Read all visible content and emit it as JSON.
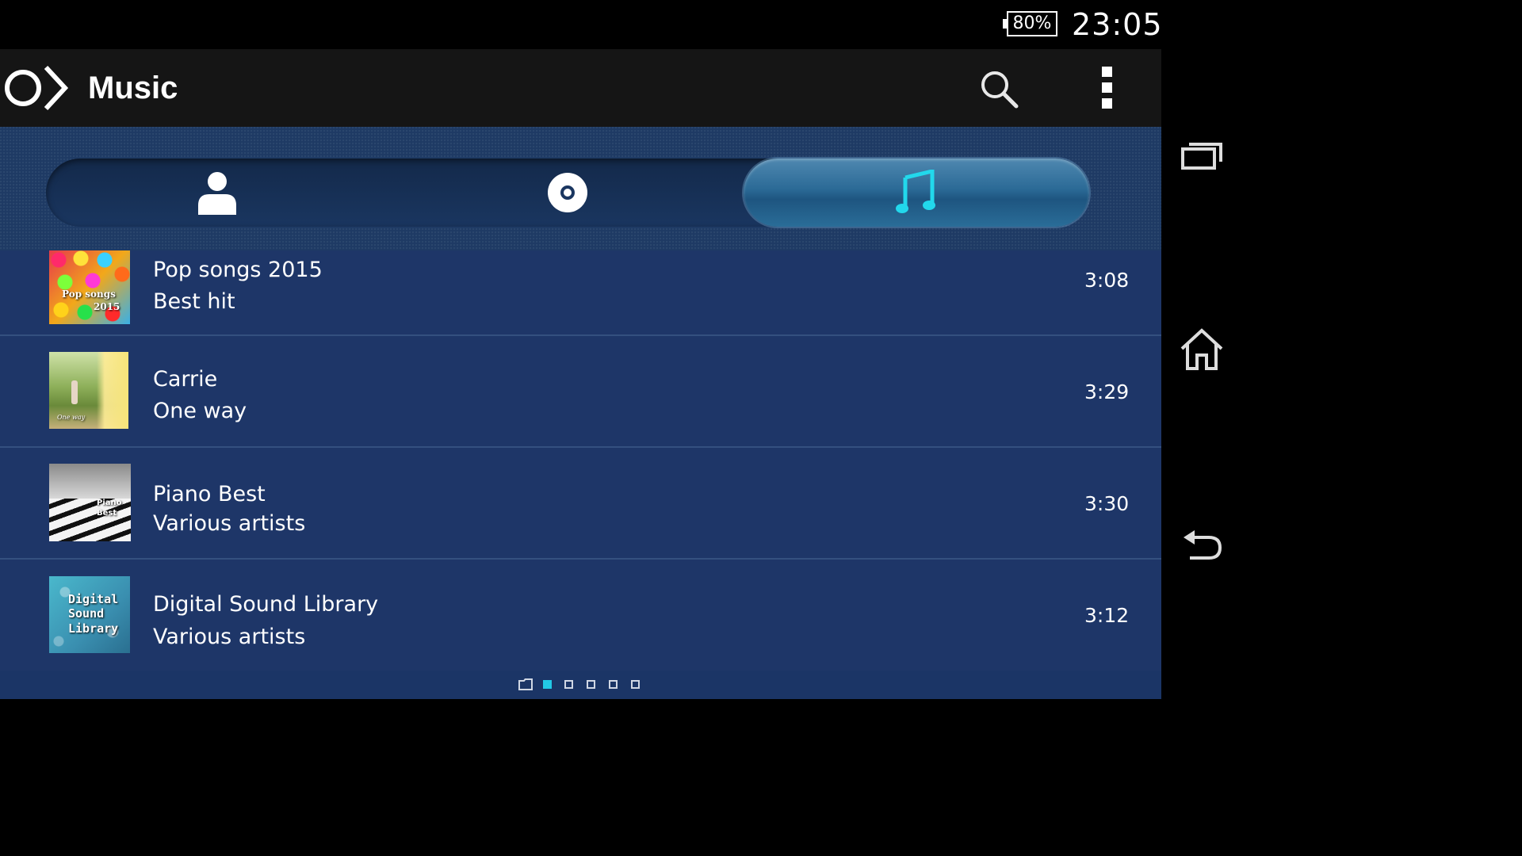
{
  "status_bar": {
    "battery": "80%",
    "time": "23:05"
  },
  "app_bar": {
    "title": "Music",
    "icons": [
      "app-logo-icon",
      "search-icon",
      "overflow-menu-icon"
    ]
  },
  "tabs": [
    {
      "icon": "person-icon",
      "selected": false
    },
    {
      "icon": "disc-icon",
      "selected": false
    },
    {
      "icon": "music-note-icon",
      "selected": true
    }
  ],
  "songs": [
    {
      "title": "Pop songs 2015",
      "artist": "Best hit",
      "duration": "3:08",
      "art_text": [
        "Pop songs",
        "2015"
      ]
    },
    {
      "title": "Carrie",
      "artist": "One way",
      "duration": "3:29",
      "art_text": [
        "One way"
      ]
    },
    {
      "title": "Piano Best",
      "artist": "Various artists",
      "duration": "3:30",
      "art_text": [
        "Piano",
        "Best"
      ]
    },
    {
      "title": "Digital Sound Library",
      "artist": "Various artists",
      "duration": "3:12",
      "art_text": [
        "Digital",
        "Sound",
        "Library"
      ]
    }
  ],
  "pager": {
    "pages": 6,
    "active_index": 1
  },
  "nav_bar": {
    "icons": [
      "recent-apps-icon",
      "home-icon",
      "back-icon"
    ]
  },
  "colors": {
    "list_bg": "#1e3668",
    "accent": "#22c9e6",
    "app_bar": "#151515"
  }
}
